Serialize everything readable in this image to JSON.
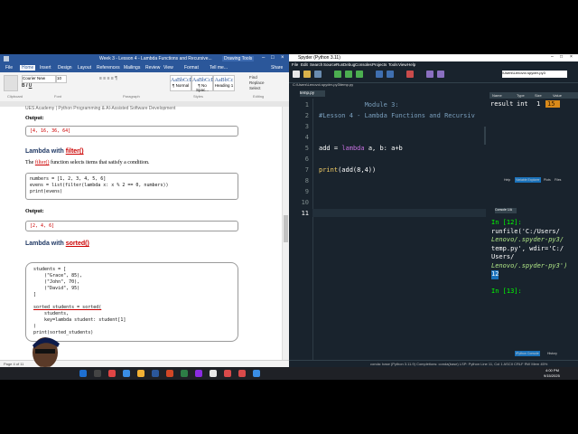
{
  "word": {
    "title": "Week 3 - Lesson 4 - Lambda Functions and Recursive...",
    "drawing_tools": "Drawing Tools",
    "tabs": [
      "File",
      "Home",
      "Insert",
      "Design",
      "Layout",
      "References",
      "Mailings",
      "Review",
      "View",
      "Format",
      "Tell me..."
    ],
    "share": "Share",
    "font_name": "Courier New",
    "font_size": "10",
    "styles": [
      {
        "sample": "AaBbCcD",
        "name": "¶ Normal"
      },
      {
        "sample": "AaBbCcD",
        "name": "¶ No Spac..."
      },
      {
        "sample": "AaBbCc",
        "name": "Heading 1"
      }
    ],
    "find": "Find",
    "replace": "Replace",
    "select": "Select",
    "group_labels": [
      "Clipboard",
      "Font",
      "Paragraph",
      "Styles",
      "Editing"
    ],
    "header_text": "UES Academy | Python Programming & AI-Assisted Software Development",
    "output_label_1": "Output:",
    "output_1": "[4, 16, 36, 64]",
    "heading_filter": "Lambda with filter()",
    "filter_desc_pre": "The ",
    "filter_desc_fn": "filter()",
    "filter_desc_post": " function selects items that satisfy a condition.",
    "filter_code": [
      "numbers = [1, 2, 3, 4, 5, 6]",
      "evens = list(filter(lambda x: x % 2 == 0, numbers))",
      "print(evens)"
    ],
    "output_label_2": "Output:",
    "output_2": "[2, 4, 6]",
    "heading_sorted": "Lambda with sorted()",
    "sorted_code": [
      "students = [",
      "    (\"Grace\", 85),",
      "    (\"John\", 70),",
      "    (\"David\", 95)",
      "]",
      "",
      "sorted_students = sorted(",
      "    students,",
      "    key=lambda student: student[1]",
      ")",
      "print(sorted_students)"
    ],
    "status": "Page 4 of 11"
  },
  "spyder": {
    "title": "Spyder (Python 3.11)",
    "menu": [
      "File",
      "Edit",
      "Search",
      "Source",
      "Run",
      "Debug",
      "Consoles",
      "Projects",
      "Tools",
      "View",
      "Help"
    ],
    "path": "C:\\Users\\Lenovo\\.spyder-py3\\temp.py",
    "right_path": "\\Users\\Lenovo\\.spyder-py3",
    "editor_tab": "temp.py",
    "line_numbers": [
      "1",
      "2",
      "3",
      "4",
      "5",
      "6",
      "7",
      "8",
      "9",
      "10",
      "11"
    ],
    "code": {
      "l1": "            Module 3:",
      "l2": "#Lesson 4 - Lambda Functions and Recursiv",
      "l5_a": "add",
      "l5_b": " = ",
      "l5_c": "lambda",
      "l5_d": " a, b: a+b",
      "l7_a": "print",
      "l7_b": "(add(8,4))"
    },
    "var_headers": [
      "Name",
      "Type",
      "Size",
      "Value"
    ],
    "variable": {
      "name": "result",
      "type": "int",
      "size": "1",
      "value": "15"
    },
    "var_tabs": [
      "Help",
      "Variable Explorer",
      "Plots",
      "Files"
    ],
    "console_tab": "Console 1/A",
    "console": {
      "prompt1": "In [12]:",
      "cmd1": "runfile('C:/Users/",
      "cmd2": "Lenovo/.spyder-py3/",
      "cmd3": "temp.py', wdir='C:/",
      "cmd4": "Users/",
      "cmd5": "Lenovo/.spyder-py3')",
      "out": "12",
      "prompt2": "In [13]:"
    },
    "console_tabs": [
      "IPython Console",
      "History"
    ],
    "status": "conda: base (Python 3.11.9)    Completions: conda(base)    LSP: Python    Line 11, Col 1    ASCII    CRLF    RW    Mem 45%"
  },
  "taskbar": {
    "time": "4:00 PM",
    "date": "9/15/2025"
  },
  "colors": {
    "word_blue": "#2b579a",
    "spyder_bg": "#19232d",
    "comment": "#7a9fbd",
    "keyword": "#c670e0",
    "builtin": "#f7d066",
    "number_out": "#4fa8ff",
    "prompt": "#00ff00",
    "string": "#b0e686"
  }
}
